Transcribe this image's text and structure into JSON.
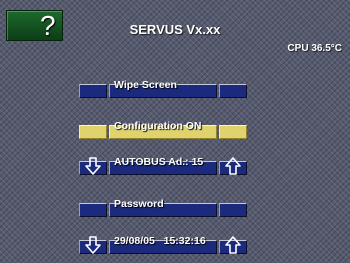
{
  "header": {
    "help_label": "?",
    "title": "SERVUS Vx.xx",
    "cpu_temp": "CPU 36.5°C"
  },
  "menu": {
    "wipe_screen": {
      "label": "Wipe Screen"
    },
    "configuration": {
      "label": "Configuration ON",
      "state": "active"
    },
    "autobus_address": {
      "label": "AUTOBUS Ad.: 15",
      "down_icon": "arrow-down-icon",
      "up_icon": "arrow-up-icon"
    },
    "password": {
      "label": "Password"
    },
    "datetime": {
      "label": "29/08/05   15:32:16",
      "down_icon": "arrow-down-icon",
      "up_icon": "arrow-up-icon"
    }
  },
  "colors": {
    "background": "#565a6e",
    "button_blue": "#1b2a7c",
    "button_active": "#e0d36e",
    "help_green": "#1d6a2c"
  }
}
